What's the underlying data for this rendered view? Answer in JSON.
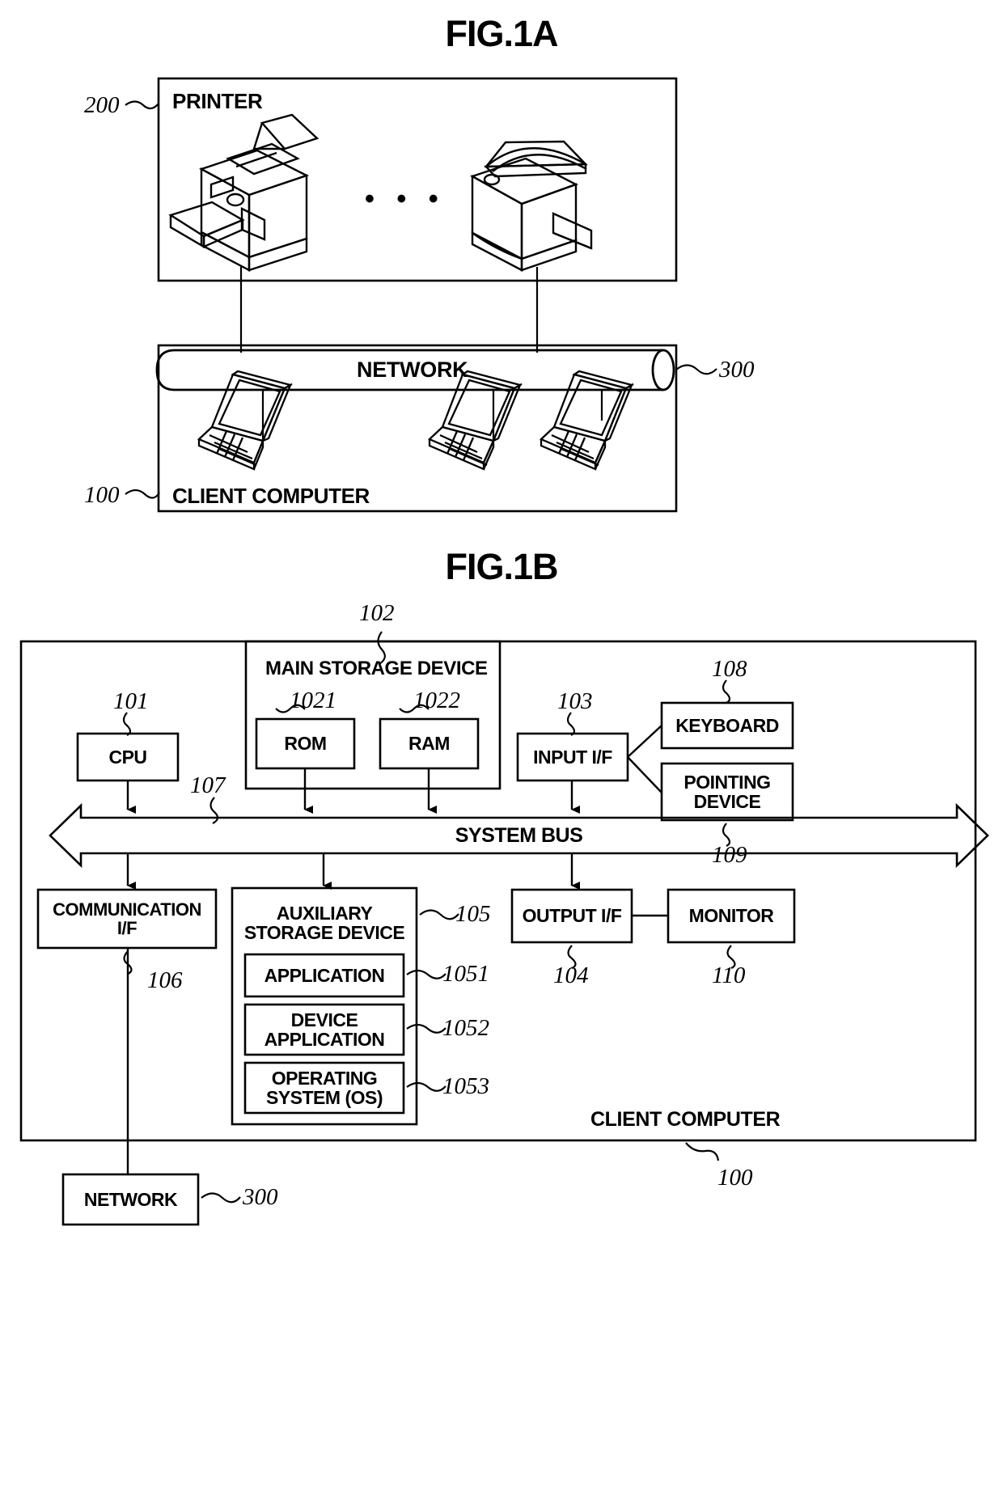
{
  "figures": {
    "fig_a": {
      "title": "FIG.1A",
      "printer_group": {
        "label": "PRINTER",
        "ref": "200",
        "devices": [
          "printer-left",
          "printer-right"
        ],
        "ellipsis": "• • •"
      },
      "network": {
        "label": "NETWORK",
        "ref": "300"
      },
      "client_group": {
        "label": "CLIENT COMPUTER",
        "ref": "100",
        "devices": [
          "laptop-1",
          "laptop-2",
          "laptop-3"
        ]
      }
    },
    "fig_b": {
      "title": "FIG.1B",
      "outer": {
        "label": "CLIENT COMPUTER",
        "ref": "100"
      },
      "cpu": {
        "label": "CPU",
        "ref": "101"
      },
      "main_storage": {
        "label": "MAIN STORAGE DEVICE",
        "ref": "102",
        "rom": {
          "label": "ROM",
          "ref": "1021"
        },
        "ram": {
          "label": "RAM",
          "ref": "1022"
        }
      },
      "input_if": {
        "label": "INPUT I/F",
        "ref": "103"
      },
      "keyboard": {
        "label": "KEYBOARD",
        "ref": "108"
      },
      "pointing_device": {
        "label": "POINTING\nDEVICE",
        "line1": "POINTING",
        "line2": "DEVICE",
        "ref": "109"
      },
      "system_bus": {
        "label": "SYSTEM BUS",
        "ref": "107"
      },
      "communication_if": {
        "line1": "COMMUNICATION",
        "line2": "I/F",
        "ref": "106"
      },
      "auxiliary_storage": {
        "line1": "AUXILIARY",
        "line2": "STORAGE DEVICE",
        "ref": "105",
        "items": [
          {
            "label": "APPLICATION",
            "ref": "1051"
          },
          {
            "line1": "DEVICE",
            "line2": "APPLICATION",
            "ref": "1052"
          },
          {
            "line1": "OPERATING",
            "line2": "SYSTEM (OS)",
            "ref": "1053"
          }
        ]
      },
      "output_if": {
        "label": "OUTPUT I/F",
        "ref": "104"
      },
      "monitor": {
        "label": "MONITOR",
        "ref": "110"
      },
      "network_box": {
        "label": "NETWORK",
        "ref": "300"
      }
    }
  }
}
